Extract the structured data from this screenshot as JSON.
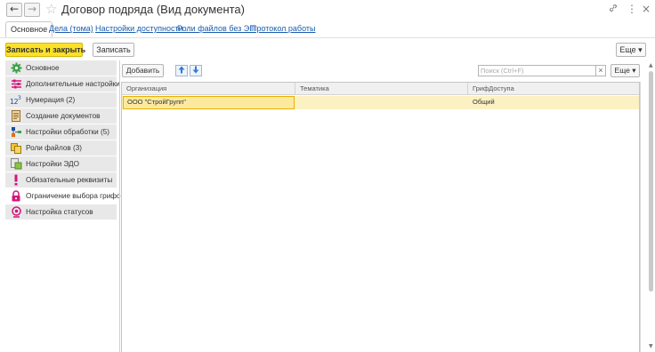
{
  "window": {
    "title": "Договор подряда (Вид документа)",
    "back_glyph": "←",
    "forward_glyph": "→",
    "star_glyph": "☆",
    "link_glyph": "🔗",
    "more_glyph": "⋮",
    "close_glyph": "×"
  },
  "tabs": [
    {
      "label": "Основное",
      "active": true
    },
    {
      "label": "Дела (тома)"
    },
    {
      "label": "Настройки доступности"
    },
    {
      "label": "Роли файлов без ЭП"
    },
    {
      "label": "Протокол работы"
    }
  ],
  "toolbar": {
    "save_close_label": "Записать и закрыть",
    "save_label": "Записать",
    "more_label": "Еще"
  },
  "sidebar": {
    "items": [
      {
        "label": "Основное",
        "icon": "gear-icon"
      },
      {
        "label": "Дополнительные настройки",
        "icon": "sliders-icon"
      },
      {
        "label": "Нумерация (2)",
        "icon": "numbering-icon"
      },
      {
        "label": "Создание документов",
        "icon": "document-icon"
      },
      {
        "label": "Настройки обработки (5)",
        "icon": "workflow-icon"
      },
      {
        "label": "Роли файлов (3)",
        "icon": "file-roles-icon"
      },
      {
        "label": "Настройки ЭДО",
        "icon": "edo-icon"
      },
      {
        "label": "Обязательные реквизиты",
        "icon": "exclamation-icon"
      },
      {
        "label": "Ограничение выбора грифов",
        "icon": "lock-icon",
        "active": true
      },
      {
        "label": "Настройка статусов",
        "icon": "status-icon"
      }
    ]
  },
  "panel": {
    "add_label": "Добавить",
    "search_placeholder": "Поиск (Ctrl+F)",
    "clear_glyph": "×",
    "more_label": "Еще",
    "columns": [
      "Организация",
      "Тематика",
      "ГрифДоступа"
    ],
    "rows": [
      {
        "org": "ООО \"СтройГрупп\"",
        "topic": "",
        "classification": "Общий"
      }
    ]
  },
  "colors": {
    "primary_button": "#fbe128",
    "link": "#1a5cae",
    "selected_row": "#fbf1c2",
    "accent_green": "#3aa34a",
    "accent_magenta": "#d4147c"
  }
}
